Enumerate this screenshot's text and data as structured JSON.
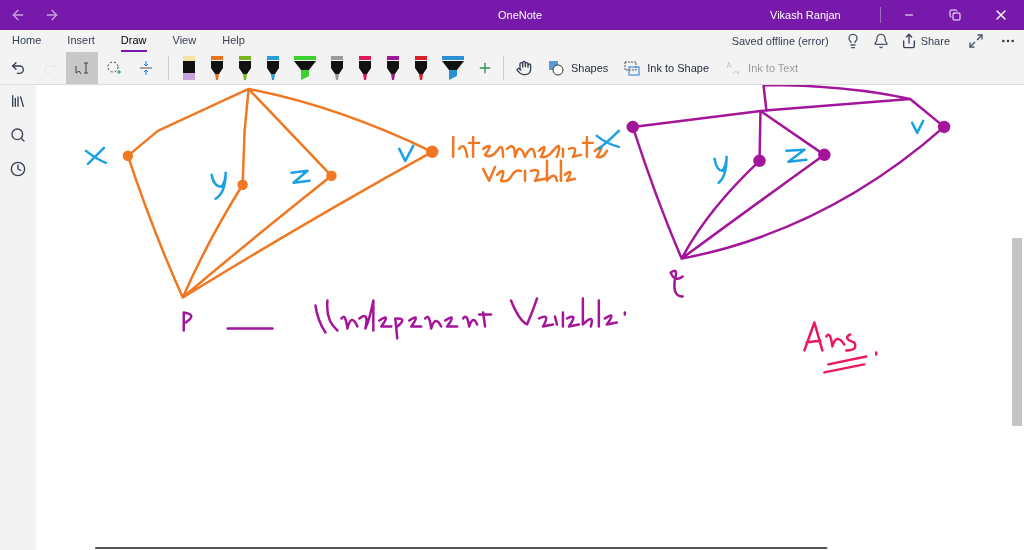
{
  "window": {
    "title": "OneNote",
    "user": "Vikash Ranjan"
  },
  "tabs": [
    {
      "label": "Home",
      "selected": false
    },
    {
      "label": "Insert",
      "selected": false
    },
    {
      "label": "Draw",
      "selected": true
    },
    {
      "label": "View",
      "selected": false
    },
    {
      "label": "Help",
      "selected": false
    }
  ],
  "status": "Saved offline (error)",
  "share": "Share",
  "tools": [
    {
      "kind": "undo",
      "disabled": false,
      "selected": false
    },
    {
      "kind": "redo",
      "disabled": true,
      "selected": false
    },
    {
      "kind": "type-select",
      "disabled": false,
      "selected": true
    },
    {
      "kind": "lasso",
      "disabled": false,
      "selected": false
    },
    {
      "kind": "space",
      "disabled": false,
      "selected": false
    }
  ],
  "pens": [
    {
      "kind": "pencil",
      "color": "#c9a2dc"
    },
    {
      "kind": "pen",
      "color": "#e8731a"
    },
    {
      "kind": "pen",
      "color": "#7ab51d"
    },
    {
      "kind": "pen",
      "color": "#2b9bd6"
    },
    {
      "kind": "highlighter",
      "color": "#3cd22e"
    },
    {
      "kind": "pen",
      "color": "#9a9a9a"
    },
    {
      "kind": "pen",
      "color": "#e0185a"
    },
    {
      "kind": "pen",
      "color": "#a0169b"
    },
    {
      "kind": "pen",
      "color": "#d61f26"
    },
    {
      "kind": "highlighter",
      "color": "#2b8fd6"
    }
  ],
  "actions": [
    {
      "kind": "shapes",
      "label": "Shapes",
      "disabled": false
    },
    {
      "kind": "ink-to-shape",
      "label": "Ink to Shape",
      "disabled": false
    },
    {
      "kind": "ink-to-text",
      "label": "Ink to Text",
      "disabled": true
    }
  ]
}
